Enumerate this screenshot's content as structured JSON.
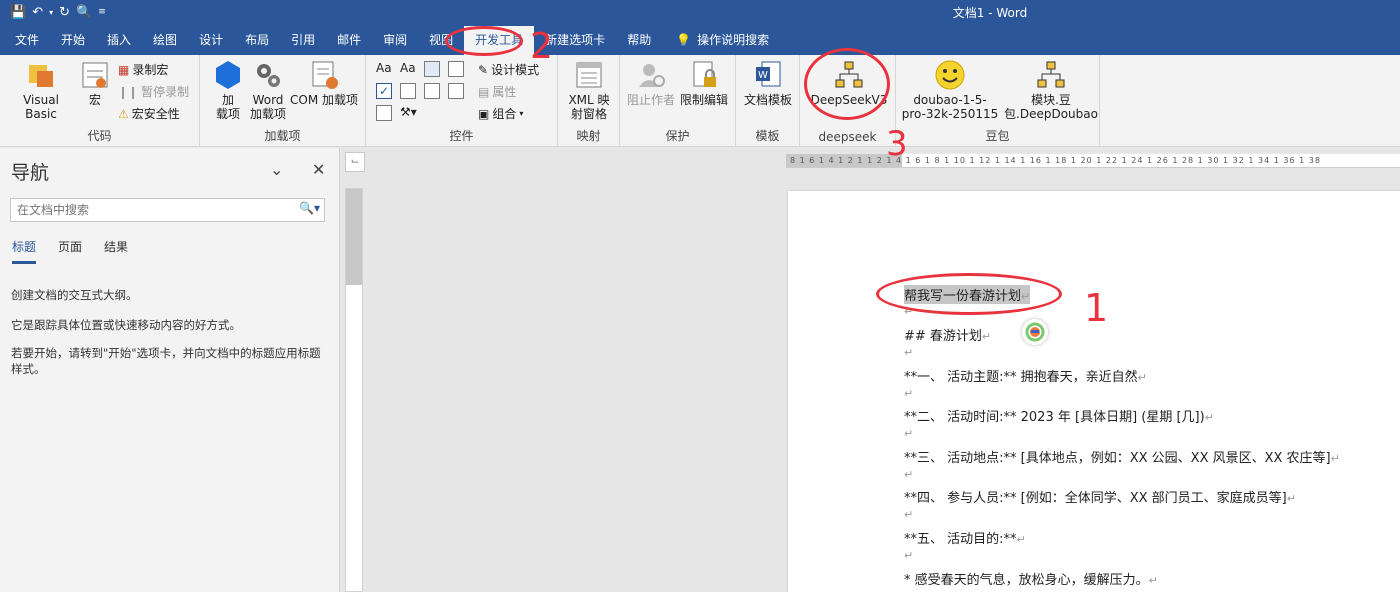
{
  "window": {
    "title": "文档1 - Word"
  },
  "qat": {
    "icons": [
      "save-icon",
      "undo-icon",
      "redo-icon",
      "print-preview-icon",
      "customize-icon"
    ]
  },
  "tabs": [
    {
      "label": "文件"
    },
    {
      "label": "开始"
    },
    {
      "label": "插入"
    },
    {
      "label": "绘图"
    },
    {
      "label": "设计"
    },
    {
      "label": "布局"
    },
    {
      "label": "引用"
    },
    {
      "label": "邮件"
    },
    {
      "label": "审阅"
    },
    {
      "label": "视图"
    },
    {
      "label": "开发工具"
    },
    {
      "label": "新建选项卡"
    },
    {
      "label": "帮助"
    }
  ],
  "tell_me": "操作说明搜索",
  "ribbon": {
    "code": {
      "label": "代码",
      "visual_basic": "Visual Basic",
      "macros": "宏",
      "record_macro": "录制宏",
      "pause_recording": "暂停录制",
      "macro_security": "宏安全性"
    },
    "addins": {
      "label": "加载项",
      "addins_btn": [
        "加",
        "载项"
      ],
      "word_addins": [
        "Word",
        "加载项"
      ],
      "com_addins": "COM 加载项"
    },
    "controls": {
      "label": "控件",
      "design_mode": "设计模式",
      "properties": "属性",
      "group": "组合"
    },
    "mapping": {
      "label": "映射",
      "xml_pane": [
        "XML 映",
        "射窗格"
      ]
    },
    "protect": {
      "label": "保护",
      "block_authors": "阻止作者",
      "restrict_editing": "限制编辑"
    },
    "templates": {
      "label": "模板",
      "doc_template": "文档模板"
    },
    "deepseek": {
      "label": "deepseek",
      "button": "DeepSeekV3"
    },
    "doubao": {
      "label": "豆包",
      "btn1": [
        "doubao-1-5-",
        "pro-32k-250115"
      ],
      "btn2": [
        "模块.豆",
        "包.DeepDoubao"
      ]
    }
  },
  "nav": {
    "title": "导航",
    "search_placeholder": "在文档中搜索",
    "tabs": [
      "标题",
      "页面",
      "结果"
    ],
    "lines": [
      "创建文档的交互式大纲。",
      "它是跟踪具体位置或快速移动内容的好方式。",
      "若要开始，请转到\"开始\"选项卡，并向文档中的标题应用标题样式。"
    ]
  },
  "ruler": {
    "h": "8 1  6 1  4 1  2 1   1  2 1  4 1  6 1  8 1 10 1 12 1 14 1 16 1 18 1 20 1 22 1 24 1 26 1 28 1 30 1 32 1 34 1 36 1 38"
  },
  "document": {
    "prompt": "帮我写一份春游计划",
    "lines": [
      "##  春游计划",
      "**一、  活动主题:**  拥抱春天，亲近自然",
      "**二、  活动时间:** 2023 年  [具体日期] (星期  [几])",
      "**三、  活动地点:** [具体地点，例如：XX 公园、XX 风景区、XX 农庄等]",
      "**四、  参与人员:** [例如：全体同学、XX 部门员工、家庭成员等]",
      "**五、  活动目的:**",
      "*  感受春天的气息，放松身心，缓解压力。"
    ],
    "para_mark": "↵"
  },
  "annotations": {
    "n1": "1",
    "n2": "2",
    "n3": "3",
    "color": "#e8333e"
  },
  "colors": {
    "brand": "#2b579a"
  }
}
